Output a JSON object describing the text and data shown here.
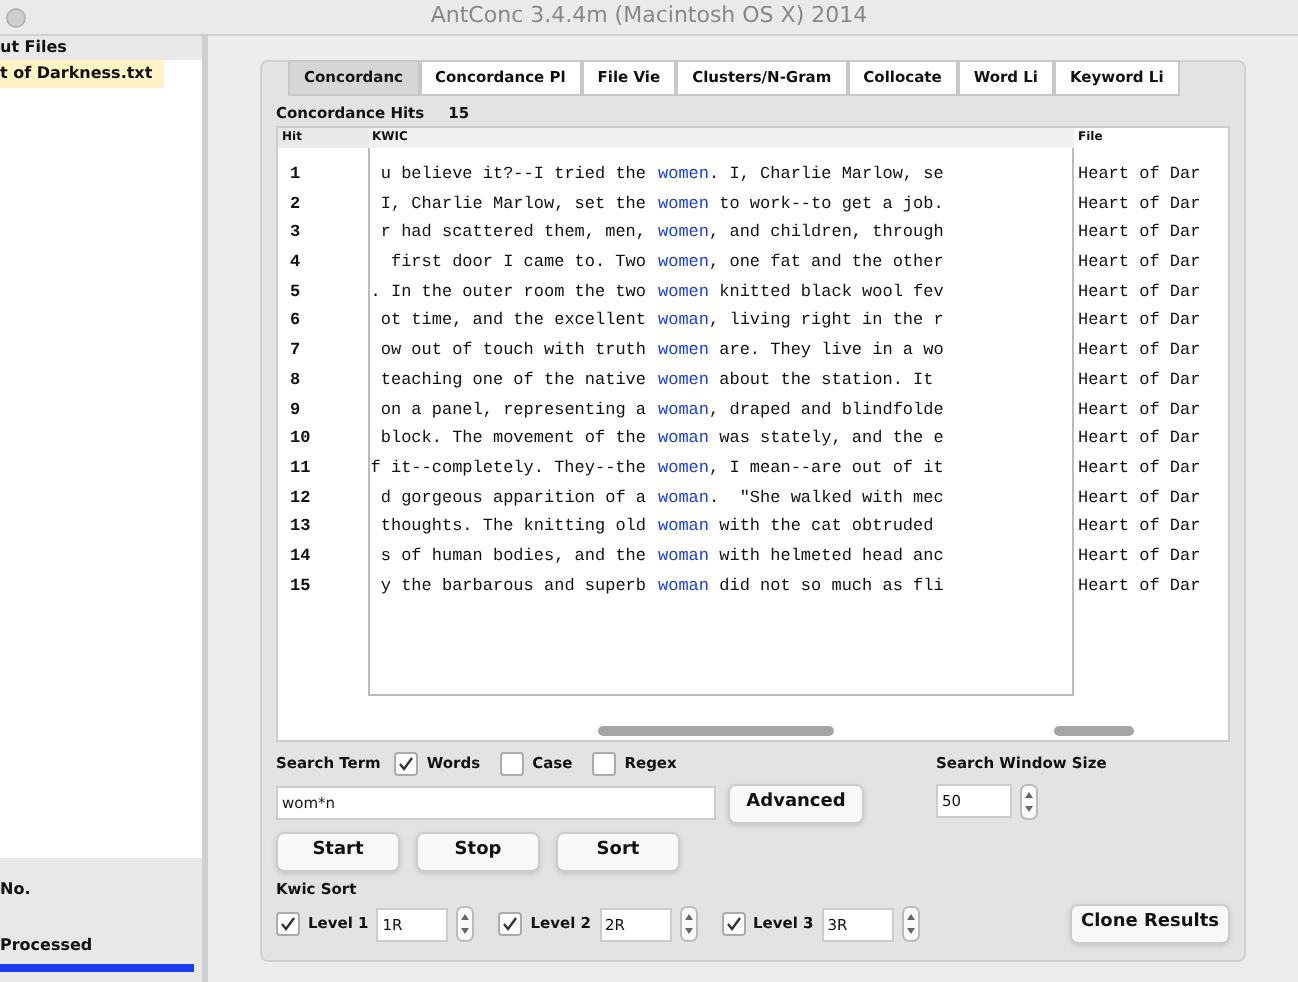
{
  "window": {
    "title": "AntConc 3.4.4m (Macintosh OS X) 2014"
  },
  "sidebar": {
    "header": "ut Files",
    "files": [
      {
        "name": "t of Darkness.txt",
        "selected": true
      }
    ],
    "total_label": "No.",
    "processed_label": "Processed",
    "progress": {
      "level": 1
    }
  },
  "tabs": [
    {
      "label": "Concordanc",
      "selected": true
    },
    {
      "label": "Concordance Pl",
      "selected": false
    },
    {
      "label": "File Vie",
      "selected": false
    },
    {
      "label": "Clusters/N-Gram",
      "selected": false
    },
    {
      "label": "Collocate",
      "selected": false
    },
    {
      "label": "Word Li",
      "selected": false
    },
    {
      "label": "Keyword Li",
      "selected": false
    }
  ],
  "hits": {
    "label": "Concordance Hits",
    "value": "15"
  },
  "table": {
    "columns": [
      "Hit",
      "KWIC",
      "File"
    ],
    "rows": [
      {
        "hit": "1",
        "left": "u believe it?--I tried the",
        "kw": "women",
        "right": ". I, Charlie Marlow, se",
        "file": "Heart of Dar"
      },
      {
        "hit": "2",
        "left": "I, Charlie Marlow, set the",
        "kw": "women",
        "right": " to work--to get a job.",
        "file": "Heart of Dar"
      },
      {
        "hit": "3",
        "left": "r had scattered them, men,",
        "kw": "women",
        "right": ", and children, through",
        "file": "Heart of Dar"
      },
      {
        "hit": "4",
        "left": "first door I came to. Two",
        "kw": "women",
        "right": ", one fat and the other",
        "file": "Heart of Dar"
      },
      {
        "hit": "5",
        "left": ". In the outer room the two",
        "kw": "women",
        "right": " knitted black wool fev",
        "file": "Heart of Dar"
      },
      {
        "hit": "6",
        "left": "ot time, and the excellent",
        "kw": "woman",
        "right": ", living right in the r",
        "file": "Heart of Dar"
      },
      {
        "hit": "7",
        "left": "ow out of touch with truth",
        "kw": "women",
        "right": " are. They live in a wo",
        "file": "Heart of Dar"
      },
      {
        "hit": "8",
        "left": "teaching one of the native",
        "kw": "women",
        "right": " about the station. It",
        "file": "Heart of Dar"
      },
      {
        "hit": "9",
        "left": "on a panel, representing a",
        "kw": "woman",
        "right": ", draped and blindfolde",
        "file": "Heart of Dar"
      },
      {
        "hit": "10",
        "left": "block. The movement of the",
        "kw": "woman",
        "right": " was stately, and the e",
        "file": "Heart of Dar"
      },
      {
        "hit": "11",
        "left": "f it--completely. They--the",
        "kw": "women",
        "right": ", I mean--are out of it",
        "file": "Heart of Dar"
      },
      {
        "hit": "12",
        "left": "d gorgeous apparition of a",
        "kw": "woman",
        "right": ".  \"She walked with mec",
        "file": "Heart of Dar"
      },
      {
        "hit": "13",
        "left": "thoughts. The knitting old",
        "kw": "woman",
        "right": " with the cat obtruded",
        "file": "Heart of Dar"
      },
      {
        "hit": "14",
        "left": "s of human bodies, and the",
        "kw": "woman",
        "right": " with helmeted head anc",
        "file": "Heart of Dar"
      },
      {
        "hit": "15",
        "left": "y the barbarous and superb",
        "kw": "woman",
        "right": " did not so much as fli",
        "file": "Heart of Dar"
      }
    ]
  },
  "search": {
    "label": "Search Term",
    "options": [
      {
        "label": "Words",
        "checked": true
      },
      {
        "label": "Case",
        "checked": false
      },
      {
        "label": "Regex",
        "checked": false
      }
    ],
    "value": "wom*n",
    "advanced": "Advanced",
    "window_label": "Search Window Size",
    "window_value": "50"
  },
  "buttons": [
    "Start",
    "Stop",
    "Sort"
  ],
  "kwic_sort": {
    "label": "Kwic Sort",
    "levels": [
      {
        "label": "Level 1",
        "checked": true,
        "value": "1R"
      },
      {
        "label": "Level 2",
        "checked": true,
        "value": "2R"
      },
      {
        "label": "Level 3",
        "checked": true,
        "value": "3R"
      }
    ],
    "clone": "Clone Results"
  }
}
